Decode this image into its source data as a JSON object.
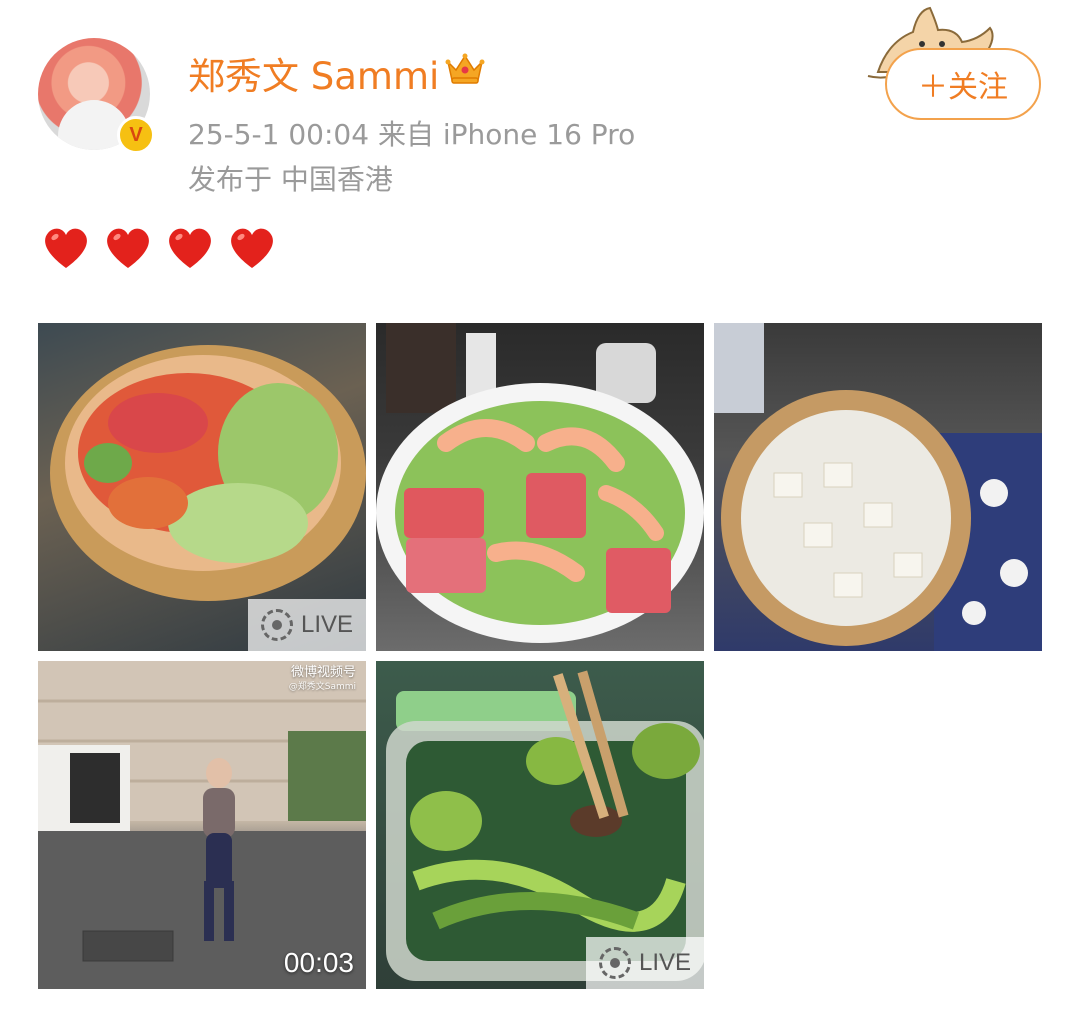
{
  "post": {
    "username": "郑秀文 Sammi",
    "timestamp_source": "25-5-1 00:04  来自 iPhone 16 Pro",
    "location": "发布于 中国香港",
    "follow_label": "＋关注",
    "verified_badge": "V",
    "text_emojis": [
      "❤️",
      "❤️",
      "❤️",
      "❤️"
    ],
    "colors": {
      "username": "#f07d23",
      "meta": "#9a9a9a",
      "follow_border": "#f3a24c",
      "verified_badge": "#f6c012",
      "heart": "#e3221c"
    }
  },
  "photos": [
    {
      "name": "salad-bowl-photo",
      "badge": "LIVE"
    },
    {
      "name": "shrimp-tuna-bowl-photo",
      "badge": ""
    },
    {
      "name": "tofu-soup-photo",
      "badge": ""
    },
    {
      "name": "running-video-photo",
      "duration": "00:03",
      "watermark_line1": "微博视频号",
      "watermark_line2": "@郑秀文Sammi"
    },
    {
      "name": "vegetables-box-photo",
      "badge": "LIVE"
    }
  ],
  "icons": {
    "crown": "crown-icon",
    "verified": "verified-icon",
    "live": "live-photo-icon",
    "dog": "dog-sticker-icon",
    "heart": "heart-icon"
  }
}
